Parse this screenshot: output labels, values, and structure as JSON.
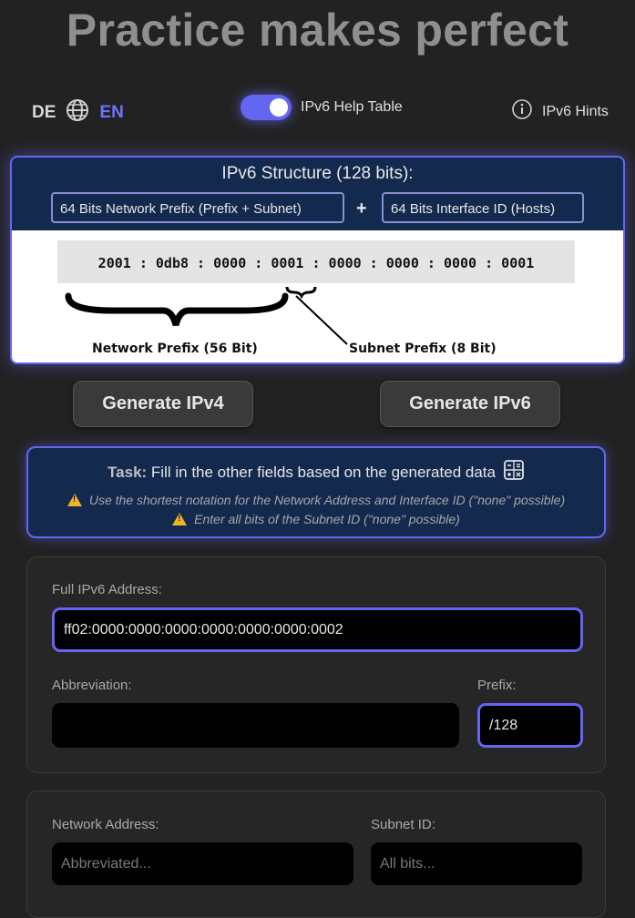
{
  "header": {
    "title": "Practice makes perfect"
  },
  "language": {
    "de": "DE",
    "en": "EN",
    "active": "EN"
  },
  "toggle": {
    "label": "IPv6 Help Table",
    "on": true
  },
  "hints": {
    "label": "IPv6 Hints"
  },
  "structure": {
    "title": "IPv6 Structure (128 bits):",
    "network_pill": "64 Bits Network Prefix (Prefix + Subnet)",
    "plus": "+",
    "interface_pill": "64 Bits Interface ID (Hosts)",
    "diagram_address": "2001 : 0db8 : 0000 : 0001 : 0000 : 0000 : 0000 : 0001",
    "network_label": "Network Prefix (56 Bit)",
    "subnet_label": "Subnet Prefix (8 Bit)"
  },
  "buttons": {
    "gen_ipv4": "Generate IPv4",
    "gen_ipv6": "Generate IPv6"
  },
  "task": {
    "label": "Task:",
    "text": "Fill in the other fields based on the generated data",
    "warn1": "Use the shortest notation for the Network Address and Interface ID (\"none\" possible)",
    "warn2": "Enter all bits of the Subnet ID (\"none\" possible)"
  },
  "form": {
    "full_label": "Full IPv6 Address:",
    "full_value": "ff02:0000:0000:0000:0000:0000:0000:0002",
    "abbr_label": "Abbreviation:",
    "abbr_value": "",
    "prefix_label": "Prefix:",
    "prefix_value": "/128",
    "network_label": "Network Address:",
    "network_placeholder": "Abbreviated...",
    "subnet_label": "Subnet ID:",
    "subnet_placeholder": "All bits..."
  },
  "colors": {
    "accent": "#6366f1",
    "panel": "#13294e",
    "background": "#222222",
    "warning": "#f0b429"
  }
}
